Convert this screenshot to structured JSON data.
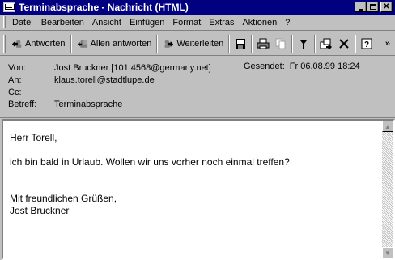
{
  "window": {
    "title": "Terminabsprache - Nachricht (HTML)"
  },
  "menu": [
    "Datei",
    "Bearbeiten",
    "Ansicht",
    "Einfügen",
    "Format",
    "Extras",
    "Aktionen",
    "?"
  ],
  "toolbar": {
    "reply": "Antworten",
    "reply_all": "Allen antworten",
    "forward": "Weiterleiten"
  },
  "headers": {
    "from_label": "Von:",
    "from_value": "Jost Bruckner [101.4568@germany.net]",
    "to_label": "An:",
    "to_value": "klaus.torell@stadtlupe.de",
    "cc_label": "Cc:",
    "cc_value": "",
    "subject_label": "Betreff:",
    "subject_value": "Terminabsprache",
    "sent_label": "Gesendet:",
    "sent_value": "Fr 06.08.99 18:24"
  },
  "message": {
    "greeting": "Herr Torell,",
    "line1": "ich bin  bald in Urlaub. Wollen wir uns vorher noch einmal treffen?",
    "closing": "Mit freundlichen Grüßen,",
    "signature": "Jost Bruckner"
  }
}
